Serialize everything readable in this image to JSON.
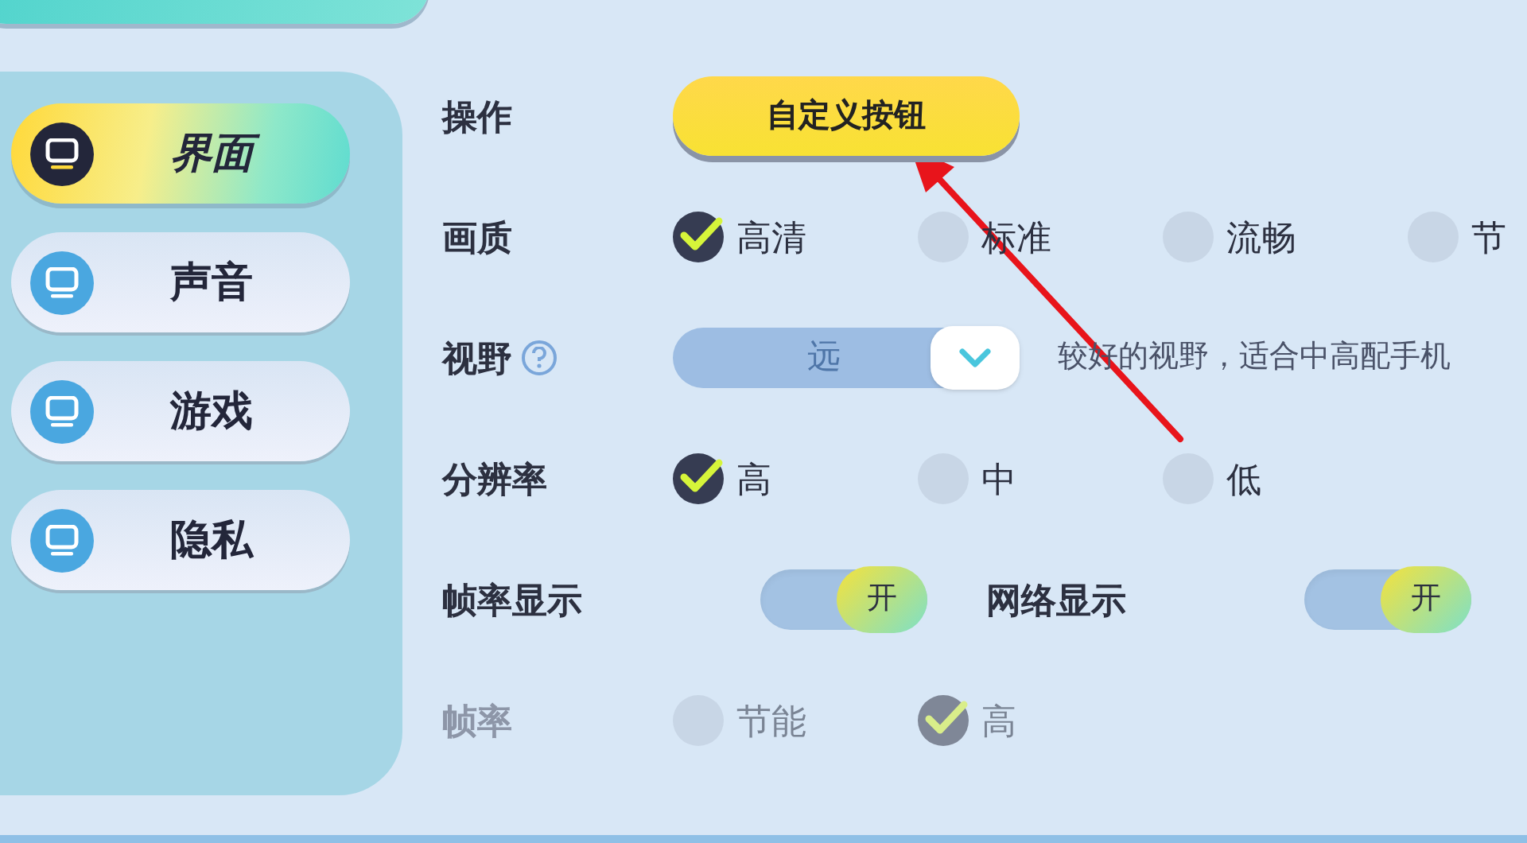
{
  "sidebar": {
    "items": [
      {
        "label": "界面",
        "selected": true
      },
      {
        "label": "声音",
        "selected": false
      },
      {
        "label": "游戏",
        "selected": false
      },
      {
        "label": "隐私",
        "selected": false
      }
    ]
  },
  "settings": [
    {
      "kind": "button",
      "label": "操作",
      "disabled": false,
      "button": "自定义按钮"
    },
    {
      "kind": "radio",
      "label": "画质",
      "disabled": false,
      "options": [
        {
          "label": "高清",
          "selected": true
        },
        {
          "label": "标准",
          "selected": false
        },
        {
          "label": "流畅",
          "selected": false
        },
        {
          "label": "节",
          "selected": false
        }
      ]
    },
    {
      "kind": "select",
      "label": "视野",
      "disabled": false,
      "help": true,
      "value": "远",
      "description": "较好的视野，适合中高配手机"
    },
    {
      "kind": "radio",
      "label": "分辨率",
      "disabled": false,
      "options": [
        {
          "label": "高",
          "selected": true
        },
        {
          "label": "中",
          "selected": false
        },
        {
          "label": "低",
          "selected": false
        }
      ]
    },
    {
      "kind": "toggles",
      "disabled": false,
      "toggles": [
        {
          "label": "帧率显示",
          "on": true,
          "state_text": "开"
        },
        {
          "label": "网络显示",
          "on": true,
          "state_text": "开"
        }
      ]
    },
    {
      "kind": "radio",
      "label": "帧率",
      "disabled": true,
      "options": [
        {
          "label": "节能",
          "selected": false
        },
        {
          "label": "高",
          "selected": true
        }
      ]
    }
  ]
}
